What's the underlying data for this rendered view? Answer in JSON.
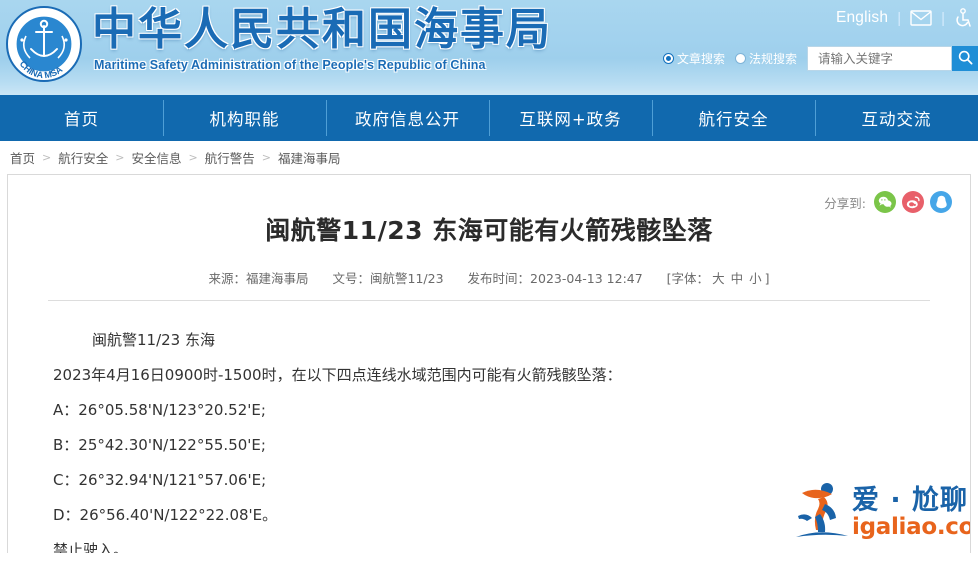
{
  "site": {
    "logo_alt": "china-msa-emblem",
    "title_cn": "中华人民共和国海事局",
    "title_en": "Maritime Safety Administration of the People's Republic of China",
    "brand_color": "#1a6bb5",
    "header_bg": "#a2d2ee",
    "nav_bg": "#1169ae"
  },
  "utility": {
    "english_label": "English",
    "separator": "|",
    "mail_icon": "envelope-icon",
    "accessibility_icon": "wheelchair-icon"
  },
  "search": {
    "options": [
      {
        "label": "文章搜索",
        "selected": true
      },
      {
        "label": "法规搜索",
        "selected": false
      }
    ],
    "placeholder": "请输入关键字",
    "value": "",
    "button_icon": "search-icon"
  },
  "nav": {
    "items": [
      {
        "label": "首页"
      },
      {
        "label": "机构职能"
      },
      {
        "label": "政府信息公开"
      },
      {
        "label": "互联网+政务"
      },
      {
        "label": "航行安全"
      },
      {
        "label": "互动交流"
      }
    ]
  },
  "breadcrumb": {
    "items": [
      "首页",
      "航行安全",
      "安全信息",
      "航行警告",
      "福建海事局"
    ],
    "separator": ">"
  },
  "share": {
    "label": "分享到:",
    "targets": [
      {
        "name": "wechat",
        "color": "#7bc549"
      },
      {
        "name": "weibo",
        "color": "#e8606a"
      },
      {
        "name": "qq",
        "color": "#46a6e8"
      }
    ]
  },
  "article": {
    "title": "闽航警11/23 东海可能有火箭残骸坠落",
    "meta": {
      "source_label": "来源：",
      "source_value": "福建海事局",
      "docno_label": "文号：",
      "docno_value": "闽航警11/23",
      "time_label": "发布时间：",
      "time_value": "2023-04-13 12:47",
      "fontsize_open": "[字体：",
      "fontsize_large": "大",
      "fontsize_medium": "中",
      "fontsize_small": "小",
      "fontsize_close": "]"
    },
    "paragraphs": [
      {
        "text": "闽航警11/23  东海",
        "indent": true
      },
      {
        "text": "2023年4月16日0900时-1500时，在以下四点连线水域范围内可能有火箭残骸坠落：",
        "indent": false
      },
      {
        "text": "A：26°05.58'N/123°20.52'E;",
        "indent": false
      },
      {
        "text": "B：25°42.30'N/122°55.50'E;",
        "indent": false
      },
      {
        "text": "C：26°32.94'N/121°57.06'E;",
        "indent": false
      },
      {
        "text": "D：26°56.40'N/122°22.08'E。",
        "indent": false
      },
      {
        "text": "禁止驶入。",
        "indent": false
      }
    ]
  },
  "watermark": {
    "icon": "running-figure-icon",
    "text_cn": "爱 · 尬聊",
    "text_en": "igaliao.com",
    "color_cn": "#1a63a8",
    "color_en": "#e8641c"
  }
}
